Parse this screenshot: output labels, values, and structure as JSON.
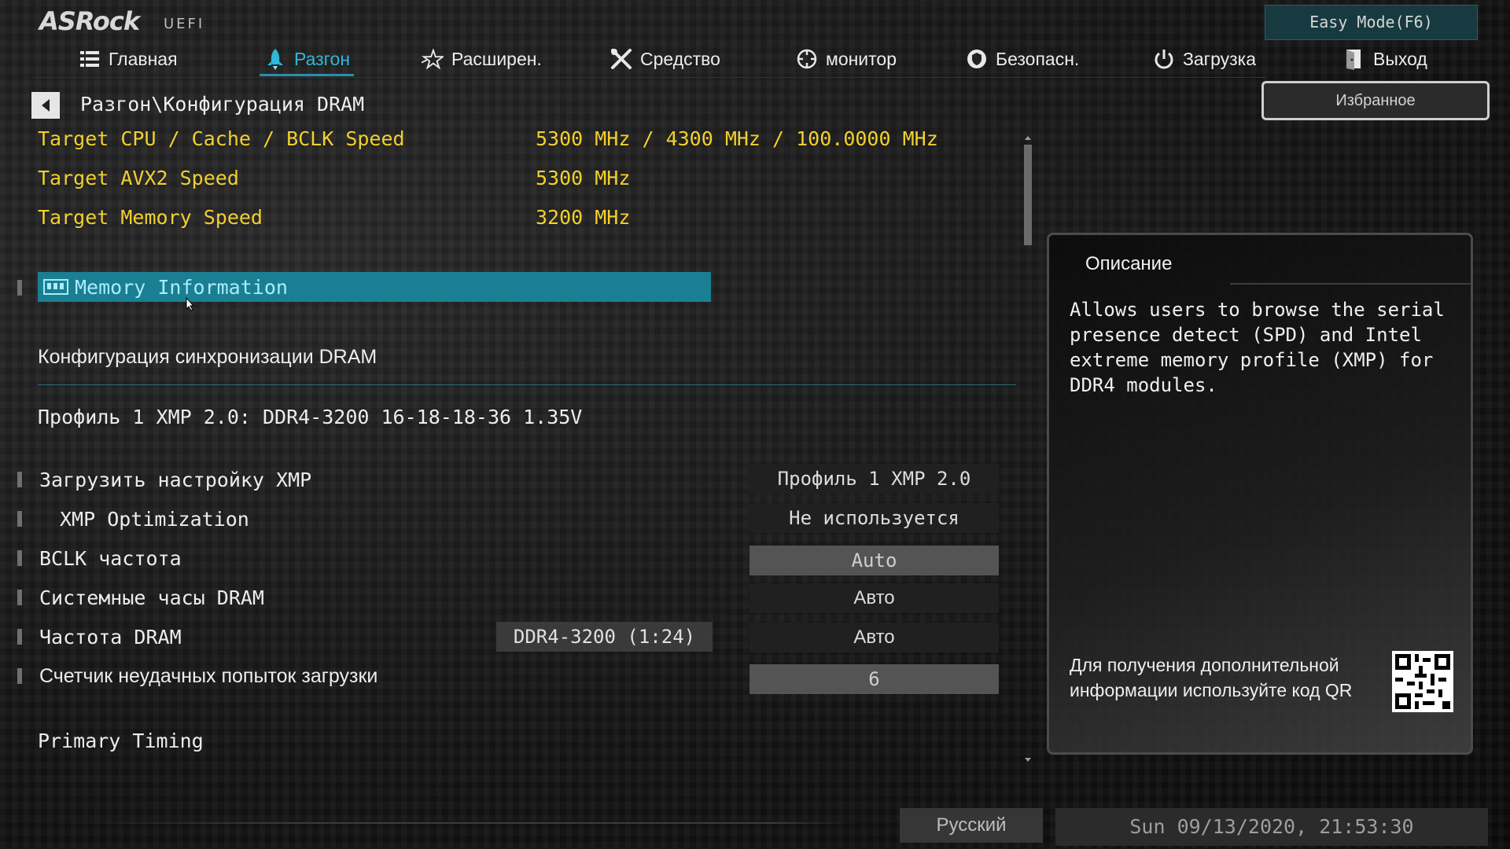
{
  "brand": {
    "logo": "ASRock",
    "sub": "UEFI"
  },
  "easy_mode": "Easy Mode(F6)",
  "nav": [
    {
      "label": "Главная",
      "icon": "list-icon"
    },
    {
      "label": "Разгон",
      "icon": "rocket-icon",
      "active": true
    },
    {
      "label": "Расширен.",
      "icon": "star-icon"
    },
    {
      "label": "Средство",
      "icon": "tools-icon"
    },
    {
      "label": "монитор",
      "icon": "monitor-icon"
    },
    {
      "label": "Безопасн.",
      "icon": "shield-icon"
    },
    {
      "label": "Загрузка",
      "icon": "power-icon"
    },
    {
      "label": "Выход",
      "icon": "exit-icon"
    }
  ],
  "favorites": "Избранное",
  "breadcrumb": "Разгон\\Конфигурация DRAM",
  "targets": [
    {
      "label": "Target CPU / Cache / BCLK Speed",
      "value": "5300 MHz / 4300 MHz / 100.0000 MHz"
    },
    {
      "label": "Target AVX2 Speed",
      "value": "5300 MHz"
    },
    {
      "label": "Target Memory Speed",
      "value": "3200 MHz"
    }
  ],
  "memory_info": "Memory Information",
  "section_title": "Конфигурация синхронизации DRAM",
  "xmp_profile_info": "Профиль 1 XMP 2.0: DDR4-3200 16-18-18-36 1.35V",
  "settings": [
    {
      "label": "Загрузить настройку XMP",
      "value": "Профиль 1 XMP 2.0"
    },
    {
      "label": "XMP Optimization",
      "value": "Не используется"
    },
    {
      "label": "BCLK частота",
      "value": "Auto"
    },
    {
      "label": "Системные часы DRAM",
      "value": "Авто"
    },
    {
      "label": "Частота DRAM",
      "readout": "DDR4-3200 (1:24)",
      "value": "Авто"
    },
    {
      "label": "Счетчик неудачных попыток загрузки",
      "value": "6"
    }
  ],
  "primary_timing": "Primary Timing",
  "description": {
    "title": "Описание",
    "text": "Allows users to browse the serial presence detect (SPD) and Intel extreme memory profile (XMP) for DDR4 modules.",
    "qr_text": "Для получения дополнительной информации используйте код QR"
  },
  "footer": {
    "language": "Русский",
    "datetime": "Sun 09/13/2020, 21:53:30"
  },
  "colors": {
    "accent": "#1a7f92",
    "highlight_text": "#f1d02e",
    "active_tab": "#2fb7d8"
  }
}
